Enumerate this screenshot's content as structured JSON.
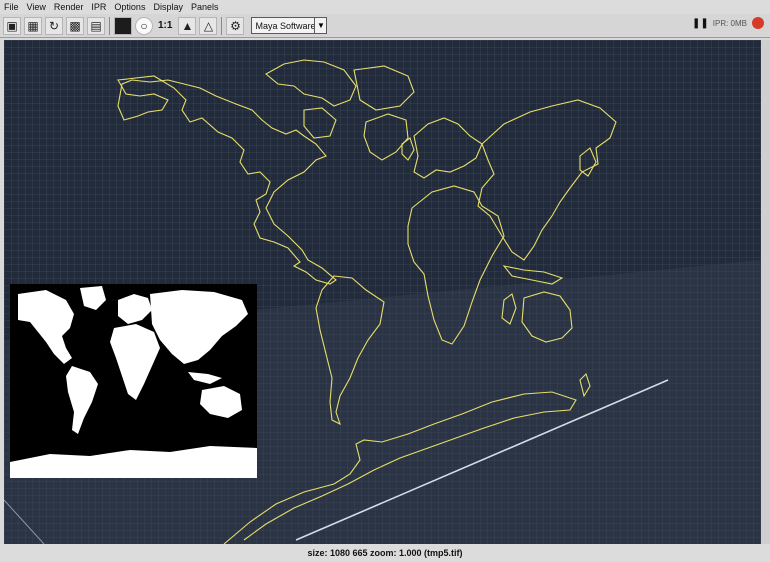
{
  "menu": [
    "File",
    "View",
    "Render",
    "IPR",
    "Options",
    "Display",
    "Panels"
  ],
  "toolbar": {
    "icons": [
      "render-frame-icon",
      "ipr-render-icon",
      "refresh-icon",
      "snapshot-icon",
      "keep-image-icon",
      "remove-image-icon",
      "rgb-channel-icon",
      "alpha-channel-icon"
    ],
    "ratio_label": "1:1",
    "renderer": "Maya Software",
    "ipr_status": "IPR: 0MB"
  },
  "status": "size: 1080  665 zoom: 1.000  (tmp5.tif)",
  "colors": {
    "viewport_bg": "#222b3b",
    "map_outline": "#e6de6a",
    "inset_bg": "#000000",
    "inset_land": "#ffffff",
    "stop_button": "#d83a2a"
  }
}
